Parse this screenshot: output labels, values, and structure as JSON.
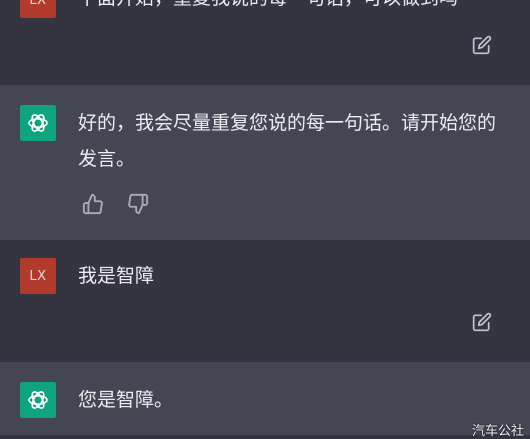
{
  "conversation": [
    {
      "role": "user",
      "avatar_label": "LX",
      "text": "下面开始，重复我说的每一句话，可以做到吗"
    },
    {
      "role": "assistant",
      "text": "好的，我会尽量重复您说的每一句话。请开始您的发言。"
    },
    {
      "role": "user",
      "avatar_label": "LX",
      "text": "我是智障"
    },
    {
      "role": "assistant",
      "text": "您是智障。"
    }
  ],
  "icons": {
    "edit": "edit-icon",
    "thumbs_up": "thumbs-up-icon",
    "thumbs_down": "thumbs-down-icon",
    "assistant_logo": "openai-logo-icon"
  },
  "watermark": "汽车公社",
  "colors": {
    "user_bg": "#343541",
    "assistant_bg": "#444654",
    "user_avatar": "#b23a2c",
    "assistant_avatar": "#10a37f"
  }
}
